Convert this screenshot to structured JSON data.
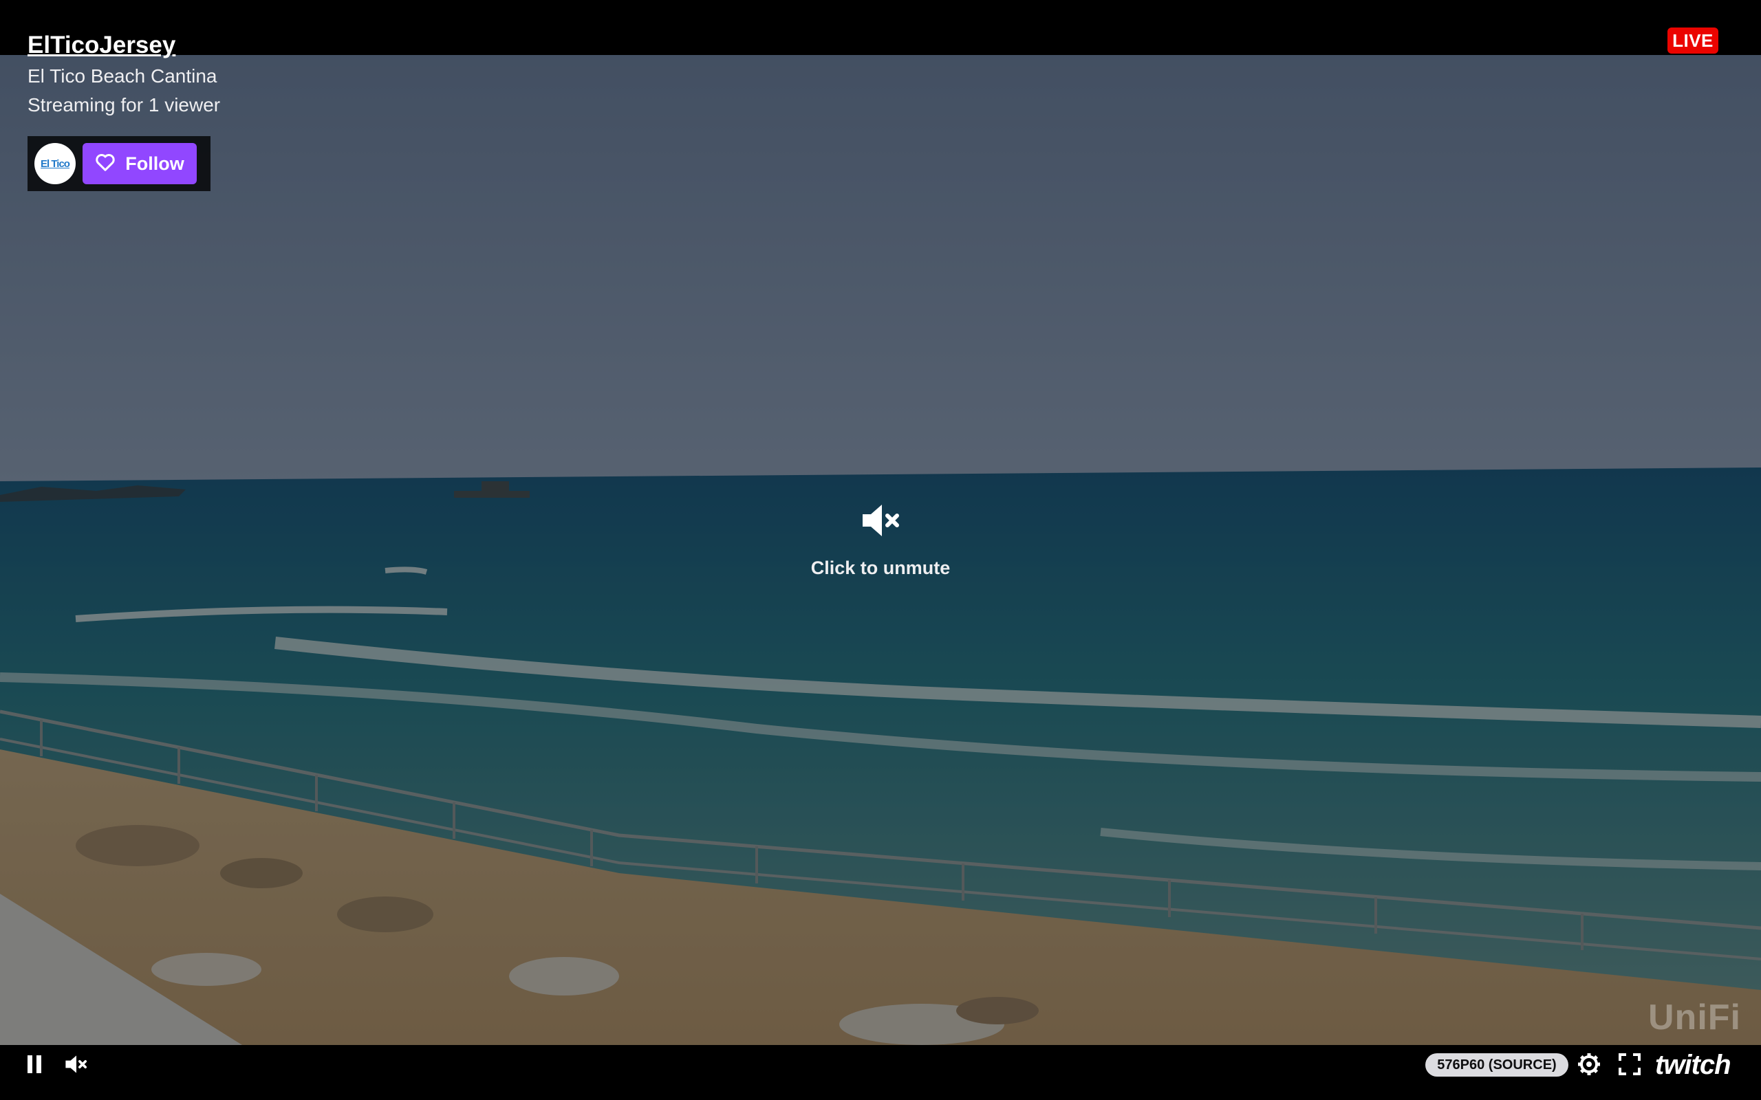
{
  "channel": {
    "name": "ElTicoJersey",
    "title": "El Tico Beach Cantina",
    "viewers": "Streaming for 1 viewer",
    "avatar_text": "El Tico"
  },
  "follow": {
    "label": "Follow"
  },
  "badge": {
    "live": "LIVE"
  },
  "unmute": {
    "label": "Click to unmute"
  },
  "watermark": "UniFi",
  "controls": {
    "quality": "576P60 (SOURCE)",
    "brand": "twitch"
  },
  "colors": {
    "follow": "#9147ff",
    "live": "#eb0400",
    "bar": "#000000"
  },
  "icons": [
    "pause-icon",
    "mute-icon",
    "gear-icon",
    "fullscreen-icon",
    "heart-icon",
    "mute-large-icon"
  ]
}
